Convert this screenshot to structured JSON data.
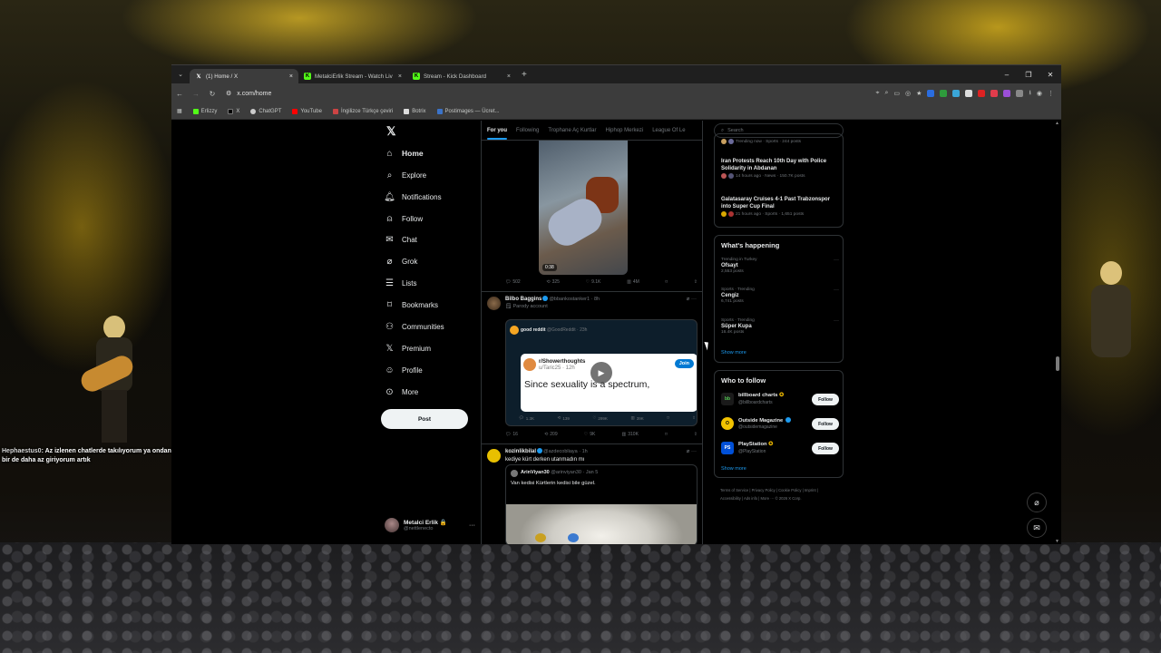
{
  "stream_chat": {
    "user": "Hephaestus0",
    "message": ": Az izlenen chatlerde takılıyorum ya ondandır belki bir de daha az giriyorum artık"
  },
  "browser": {
    "tabs": [
      {
        "title": "(1) Home / X",
        "favicon": "x-icon",
        "active": true
      },
      {
        "title": "MetalciErlik Stream - Watch Liv",
        "favicon": "kick-icon",
        "active": false
      },
      {
        "title": "Stream - Kick Dashboard",
        "favicon": "kick-icon",
        "active": false
      }
    ],
    "url": "x.com/home",
    "bookmarks": [
      "Erlizzy",
      "X",
      "ChatGPT",
      "YouTube",
      "İngilizce Türkçe çeviri",
      "Botrix",
      "Postimages — Ücret..."
    ]
  },
  "nav": {
    "items": [
      "Home",
      "Explore",
      "Notifications",
      "Follow",
      "Chat",
      "Grok",
      "Lists",
      "Bookmarks",
      "Communities",
      "Premium",
      "Profile",
      "More"
    ],
    "post_label": "Post",
    "account": {
      "name": "Metalci Erlik 🔒",
      "handle": "@nettlenecto"
    }
  },
  "timeline": {
    "tabs": [
      "For you",
      "Following",
      "Trophane Aç Kurtlar",
      "Hiphop Merkezi",
      "League Of Le"
    ],
    "video_duration": "0:38",
    "video_stats": {
      "replies": "502",
      "reposts": "325",
      "likes": "9.1K",
      "views": "4M"
    },
    "tweet1": {
      "name": "Bilbo Baggins",
      "handle": "@bbankostanker1",
      "time": "· 8h",
      "sub": "Parody account",
      "reddit_user": "good reddit",
      "reddit_handle": "@GoodReddit",
      "reddit_time": "· 23h",
      "sub_name": "r/Showerthoughts",
      "sub_user": "u/Taric25 · 12h",
      "join": "Join",
      "text": "Since sexuality is a spectrum,",
      "inner_stats": {
        "replies": "1.3K",
        "reposts": "139",
        "likes": "299K",
        "views": "39K"
      },
      "stats": {
        "replies": "16",
        "reposts": "209",
        "likes": "9K",
        "views": "310K"
      }
    },
    "tweet2": {
      "name": "kozinlikbilal",
      "handle": "@azdecobliaya",
      "time": "· 1h",
      "text": "kediye kürt derken utanmadın mı",
      "quote_name": "ArinViyan30",
      "quote_handle": "@arinviyan30",
      "quote_time": "· Jan 5",
      "quote_text": "Van kedisi Kürtlerin kedisi bile güzel."
    }
  },
  "right": {
    "search_placeholder": "Search",
    "trends_top": [
      {
        "title": "",
        "meta": "Trending now · Sports · 244 posts"
      },
      {
        "title": "Iran Protests Reach 10th Day with Police Solidarity in Abdanan",
        "meta": "14 hours ago · News · 150.7K posts"
      },
      {
        "title": "Galatasaray Cruises 4-1 Past Trabzonspor into Super Cup Final",
        "meta": "21 hours ago · Sports · 1,651 posts"
      }
    ],
    "happening_title": "What's happening",
    "happening": [
      {
        "context": "Trending in Turkey",
        "name": "Ofsayt",
        "posts": "2,553 posts"
      },
      {
        "context": "Sports · Trending",
        "name": "Cengiz",
        "posts": "6,741 posts"
      },
      {
        "context": "Sports · Trending",
        "name": "Süper Kupa",
        "posts": "16.4K posts"
      }
    ],
    "show_more": "Show more",
    "wtf_title": "Who to follow",
    "who_to_follow": [
      {
        "name": "billboard charts",
        "handle": "@billboardcharts",
        "avatar": "bb",
        "color": "#1a1a1a"
      },
      {
        "name": "Outside Magazine",
        "handle": "@outsidemagazine",
        "avatar": "O",
        "color": "#f2c200"
      },
      {
        "name": "PlayStation",
        "handle": "@PlayStation",
        "avatar": "PS",
        "color": "#0050d8"
      }
    ],
    "follow_label": "Follow",
    "footer": "Terms of Service | Privacy Policy | Cookie Policy | Imprint | Accessibility | Ads info | More ··· © 2026 X Corp."
  }
}
